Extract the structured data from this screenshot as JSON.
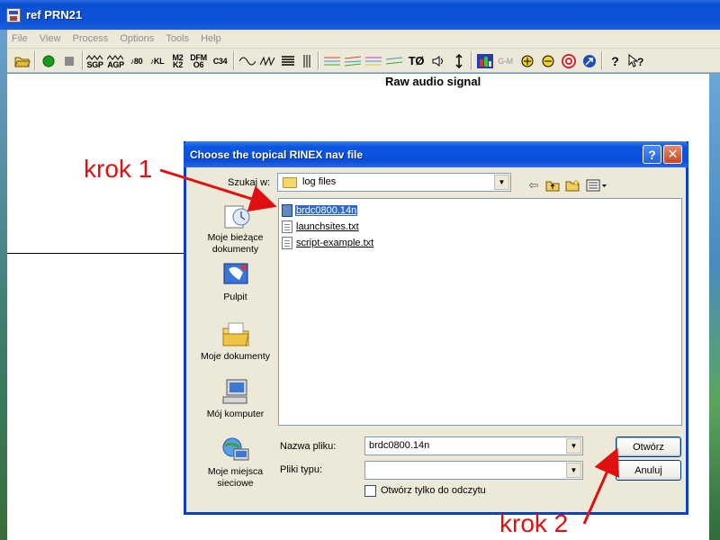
{
  "window": {
    "title": "ref PRN21"
  },
  "menu": [
    "File",
    "View",
    "Process",
    "Options",
    "Tools",
    "Help"
  ],
  "toolbar": {
    "text_buttons": {
      "sgp": "SGP",
      "agp": "AGP",
      "n80": "80",
      "kl": "KL",
      "m2k2": "M2\nK2",
      "dfmo6": "DFM\nO6",
      "c34": "C34",
      "gm": "G-M",
      "tz": "TØ"
    },
    "colors": {
      "record": "#1a9a1a",
      "stop": "#8a8a8a",
      "accent_red": "#e01010"
    }
  },
  "main": {
    "graph_title": "Raw audio signal"
  },
  "dialog": {
    "title": "Choose the topical RINEX nav file",
    "look_in_label": "Szukaj w:",
    "look_in_value": "log files",
    "places": [
      {
        "label": "Moje bieżące dokumenty",
        "icon": "recent-documents-icon"
      },
      {
        "label": "Pulpit",
        "icon": "desktop-icon"
      },
      {
        "label": "Moje dokumenty",
        "icon": "my-documents-icon"
      },
      {
        "label": "Mój komputer",
        "icon": "my-computer-icon"
      },
      {
        "label": "Moje miejsca sieciowe",
        "icon": "network-places-icon"
      }
    ],
    "files": [
      {
        "name": "brdc0800.14n",
        "selected": true
      },
      {
        "name": "launchsites.txt",
        "selected": false
      },
      {
        "name": "script-example.txt",
        "selected": false
      }
    ],
    "file_name_label": "Nazwa pliku:",
    "file_name_value": "brdc0800.14n",
    "file_type_label": "Pliki typu:",
    "file_type_value": "",
    "readonly_label": "Otwórz tylko do odczytu",
    "open_button": "Otwórz",
    "cancel_button": "Anuluj"
  },
  "annotations": {
    "step1": "krok 1",
    "step2": "krok 2"
  }
}
